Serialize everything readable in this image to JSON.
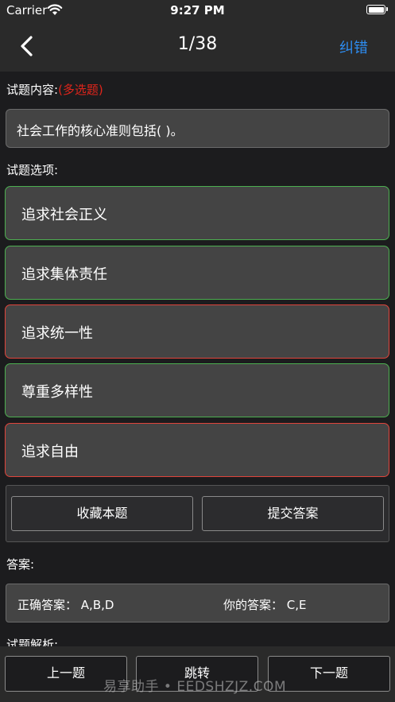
{
  "status_bar": {
    "carrier": "Carrier",
    "time": "9:27 PM"
  },
  "nav": {
    "title": "1/38",
    "right_label": "纠错"
  },
  "question": {
    "content_label": "试题内容:",
    "type_tag": "(多选题)",
    "text": "社会工作的核心准则包括(   )。",
    "options_label": "试题选项:",
    "options": [
      {
        "label": "追求社会正义",
        "state": "correct"
      },
      {
        "label": "追求集体责任",
        "state": "correct"
      },
      {
        "label": "追求统一性",
        "state": "wrong"
      },
      {
        "label": "尊重多样性",
        "state": "correct"
      },
      {
        "label": "追求自由",
        "state": "wrong"
      }
    ]
  },
  "actions": {
    "favorite": "收藏本题",
    "submit": "提交答案"
  },
  "answer": {
    "label": "答案:",
    "correct_label": "正确答案：",
    "correct_value": "A,B,D",
    "yours_label": "你的答案：",
    "yours_value": "C,E"
  },
  "analysis_label": "试题解析:",
  "bottom": {
    "prev": "上一题",
    "jump": "跳转",
    "next": "下一题"
  },
  "watermark": "易享助手 • EEDSHZJZ.COM",
  "colors": {
    "accent": "#2d8cf0",
    "correct": "#4caf50",
    "wrong": "#e0443b",
    "tag": "#e0251b"
  }
}
